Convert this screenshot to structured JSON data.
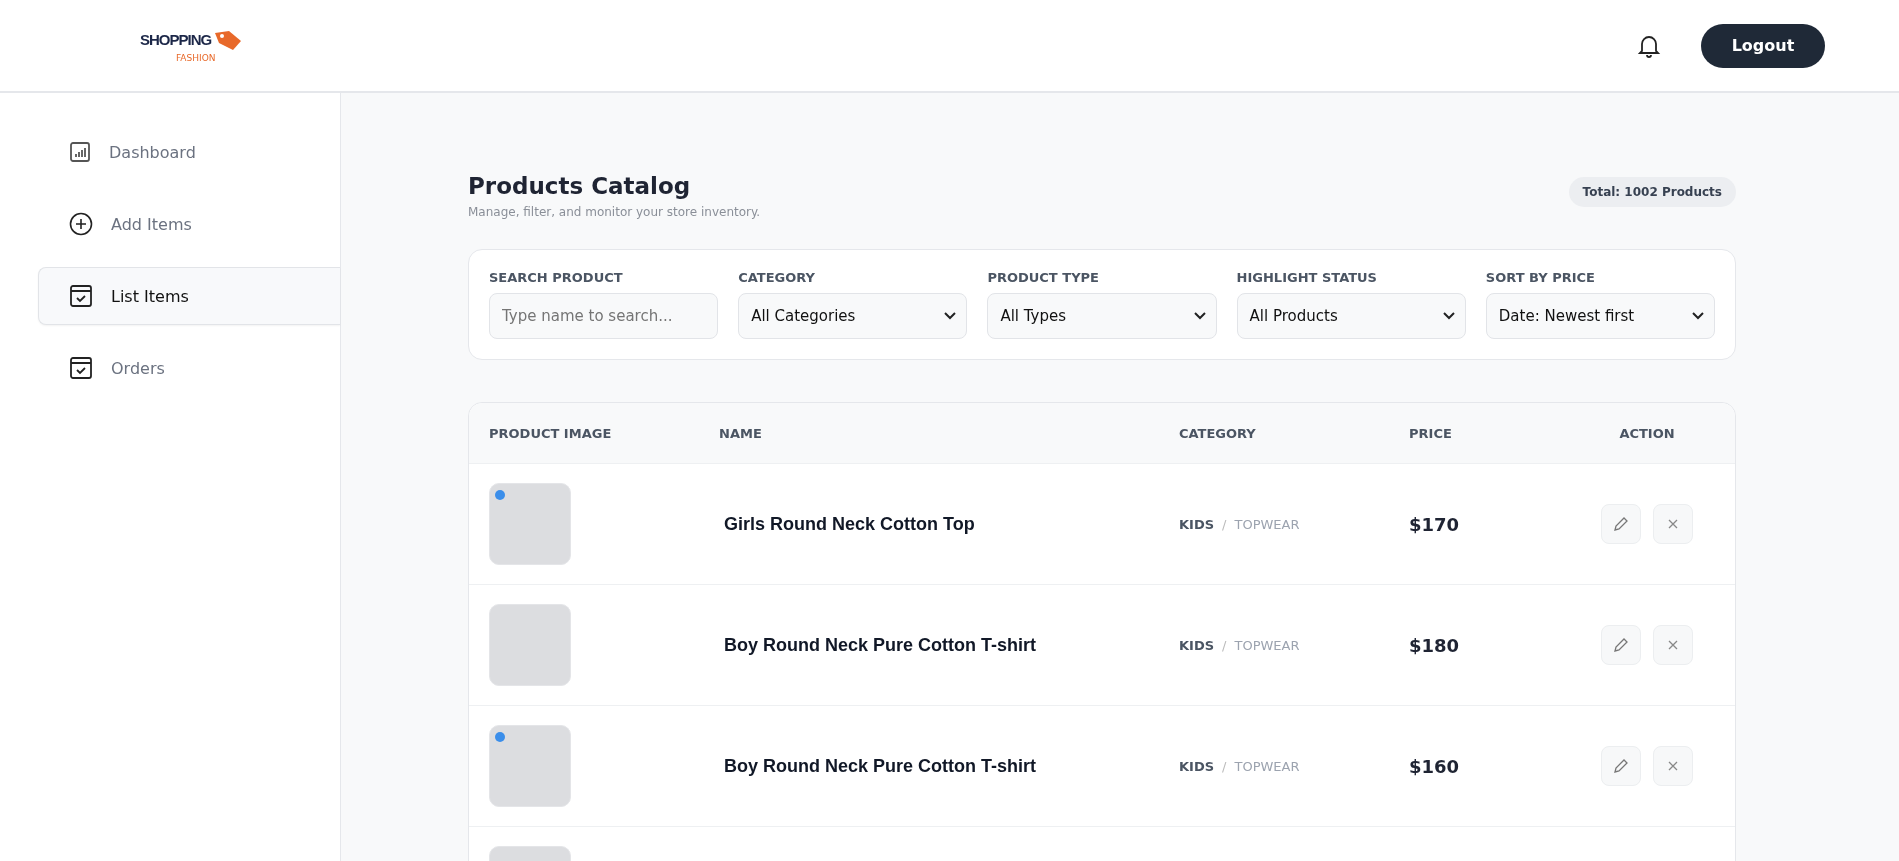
{
  "header": {
    "logo": {
      "text": "SHOPPING",
      "tagline": "FASHION"
    },
    "logout": "Logout"
  },
  "sidebar": {
    "items": [
      {
        "label": "Dashboard",
        "selected": false
      },
      {
        "label": "Add Items",
        "selected": false
      },
      {
        "label": "List Items",
        "selected": true
      },
      {
        "label": "Orders",
        "selected": false
      }
    ]
  },
  "page": {
    "title": "Products Catalog",
    "subtitle": "Manage, filter, and monitor your store inventory.",
    "total": "Total: 1002 Products"
  },
  "filters": [
    {
      "kind": "input",
      "label": "SEARCH PRODUCT",
      "placeholder": "Type name to search..."
    },
    {
      "kind": "select",
      "label": "CATEGORY",
      "value": "All Categories"
    },
    {
      "kind": "select",
      "label": "PRODUCT TYPE",
      "value": "All Types"
    },
    {
      "kind": "select",
      "label": "HIGHLIGHT STATUS",
      "value": "All Products"
    },
    {
      "kind": "select",
      "label": "SORT BY PRICE",
      "value": "Date: Newest first"
    }
  ],
  "table": {
    "columns": [
      "PRODUCT IMAGE",
      "NAME",
      "CATEGORY",
      "PRICE",
      "ACTION"
    ],
    "rows": [
      {
        "highlighted": true,
        "name": "Girls Round Neck Cotton Top",
        "category": "KIDS",
        "separator": "/",
        "subcategory": "TOPWEAR",
        "price": "$170"
      },
      {
        "highlighted": false,
        "name": "Boy Round Neck Pure Cotton T-shirt",
        "category": "KIDS",
        "separator": "/",
        "subcategory": "TOPWEAR",
        "price": "$180"
      },
      {
        "highlighted": true,
        "name": "Boy Round Neck Pure Cotton T-shirt",
        "category": "KIDS",
        "separator": "/",
        "subcategory": "TOPWEAR",
        "price": "$160"
      },
      {
        "highlighted": false
      }
    ]
  }
}
